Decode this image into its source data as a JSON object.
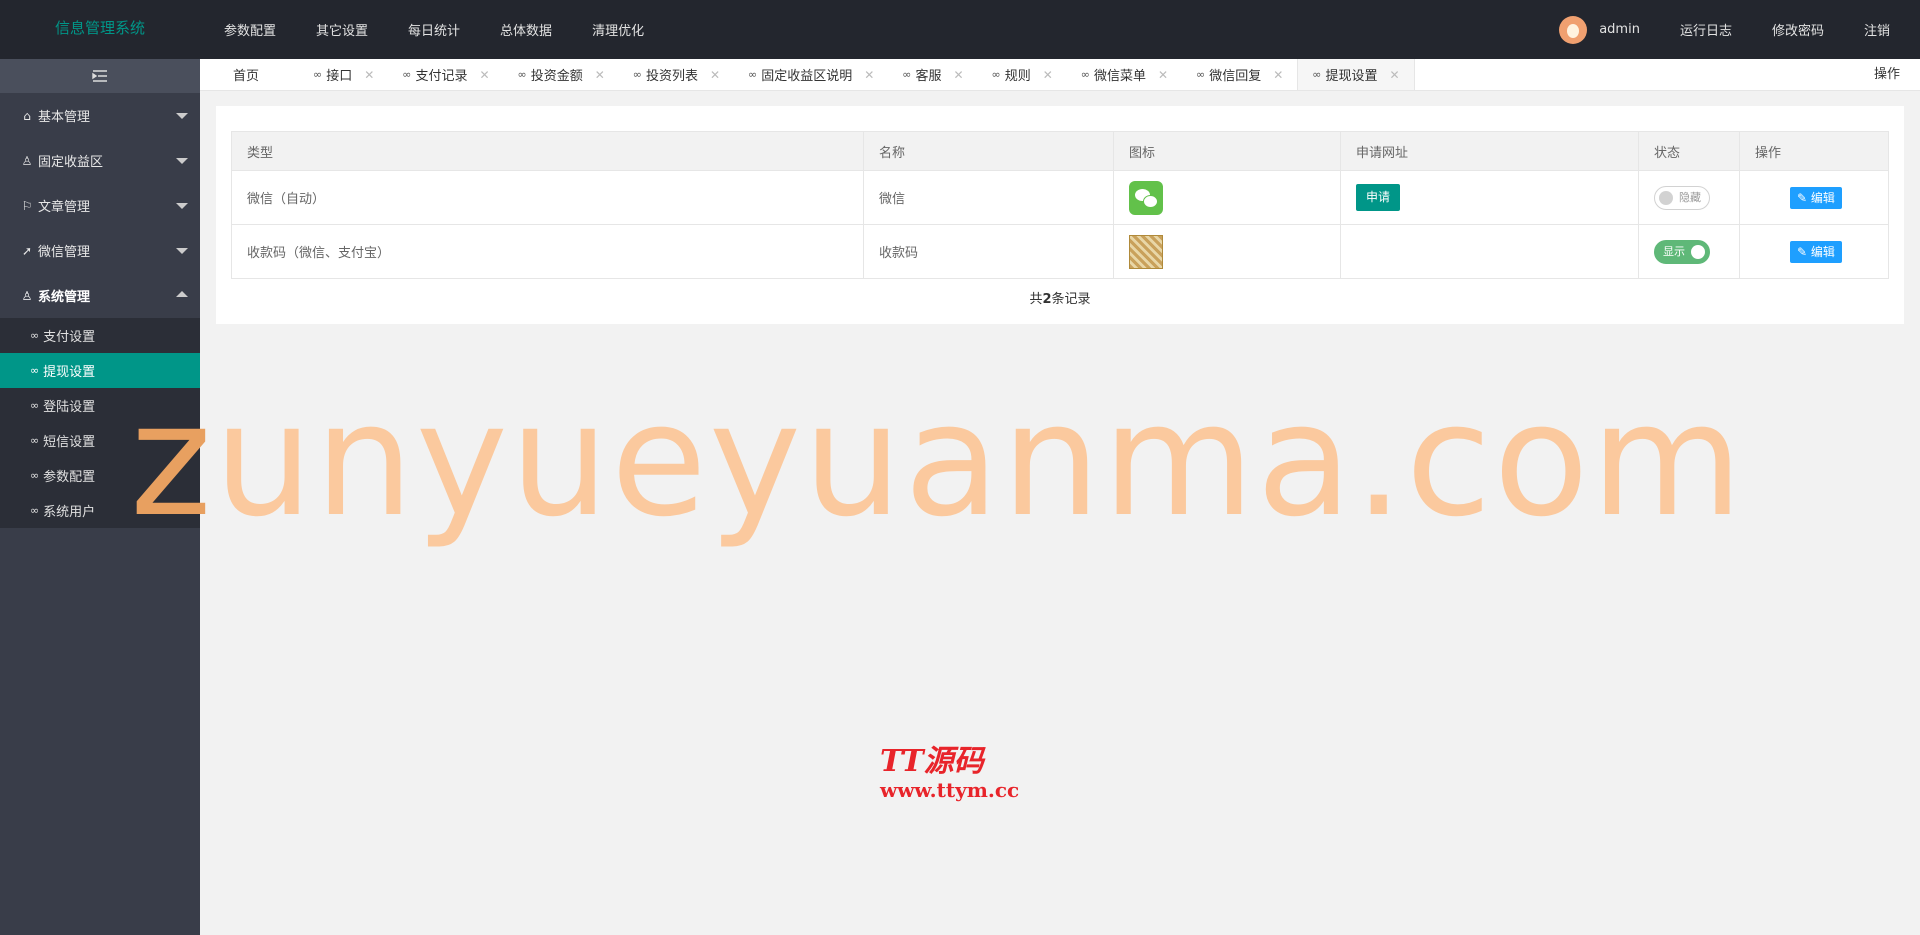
{
  "header": {
    "logo": "信息管理系统",
    "nav": [
      "参数配置",
      "其它设置",
      "每日统计",
      "总体数据",
      "清理优化"
    ],
    "user": "admin",
    "links": [
      "运行日志",
      "修改密码",
      "注销"
    ]
  },
  "sidebar": {
    "menus": [
      {
        "label": "基本管理",
        "icon": "home-icon"
      },
      {
        "label": "固定收益区",
        "icon": "user-icon"
      },
      {
        "label": "文章管理",
        "icon": "flag-icon"
      },
      {
        "label": "微信管理",
        "icon": "send-icon"
      }
    ],
    "open_menu": {
      "label": "系统管理",
      "icon": "user-icon"
    },
    "sub": [
      "支付设置",
      "提现设置",
      "登陆设置",
      "短信设置",
      "参数配置",
      "系统用户"
    ],
    "active_sub": "提现设置"
  },
  "tabs": {
    "home": "首页",
    "items": [
      "接口",
      "支付记录",
      "投资金额",
      "投资列表",
      "固定收益区说明",
      "客服",
      "规则",
      "微信菜单",
      "微信回复",
      "提现设置"
    ],
    "active": "提现设置",
    "operation": "操作"
  },
  "table": {
    "headers": [
      "类型",
      "名称",
      "图标",
      "申请网址",
      "状态",
      "操作"
    ],
    "rows": [
      {
        "type": "微信（自动）",
        "name": "微信",
        "icon": "wechat-icon",
        "apply": "申请",
        "status": "隐藏",
        "status_on": false,
        "edit": "编辑"
      },
      {
        "type": "收款码（微信、支付宝）",
        "name": "收款码",
        "icon": "qrcode-image",
        "apply": "",
        "status": "显示",
        "status_on": true,
        "edit": "编辑"
      }
    ],
    "total_prefix": "共",
    "total_count": "2",
    "total_suffix": "条记录"
  },
  "watermark": {
    "first": "z",
    "rest": "unyueyuanma.com"
  },
  "brand": {
    "line1": "TT源码",
    "line2": "www.ttym.cc"
  },
  "colors": {
    "accent": "#009688",
    "header": "#23262e",
    "sidebar": "#393d49",
    "edit": "#1e9fff",
    "switch_on": "#5fb878"
  }
}
